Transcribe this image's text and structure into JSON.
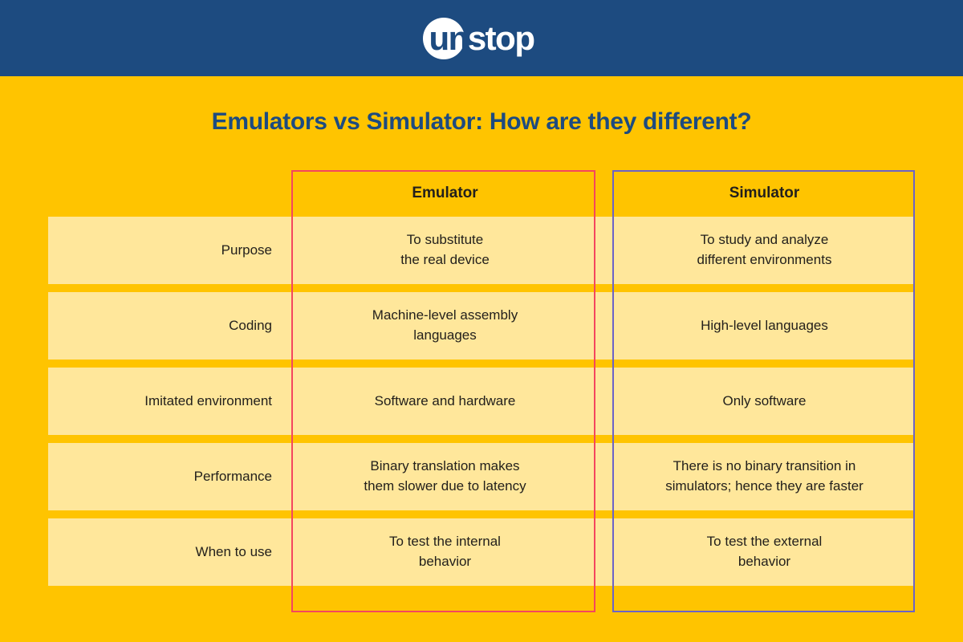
{
  "brand": {
    "logo_first": "un",
    "logo_second": "stop",
    "logo_icon": "unstop-logo"
  },
  "title": "Emulators vs Simulator: How are they different?",
  "colors": {
    "brandbar_blue": "#1D4B80",
    "background_gold": "#FFC400",
    "row_cream": "#FFE79B",
    "emulator_outline_red": "#F4465E",
    "simulator_outline_purple": "#6C63C7",
    "title_blue": "#1D4B80",
    "body_text": "#23201C"
  },
  "table": {
    "columns": [
      {
        "key": "attribute",
        "label": ""
      },
      {
        "key": "emulator",
        "label": "Emulator"
      },
      {
        "key": "simulator",
        "label": "Simulator"
      }
    ],
    "rows": [
      {
        "attribute": "Purpose",
        "emulator": "To substitute\nthe real device",
        "simulator": "To study and analyze\ndifferent environments"
      },
      {
        "attribute": "Coding",
        "emulator": "Machine-level assembly\nlanguages",
        "simulator": "High-level languages"
      },
      {
        "attribute": "Imitated environment",
        "emulator": "Software and hardware",
        "simulator": "Only software"
      },
      {
        "attribute": "Performance",
        "emulator": "Binary translation makes\nthem slower due to latency",
        "simulator": "There is no binary transition in\nsimulators; hence they are faster"
      },
      {
        "attribute": "When to use",
        "emulator": "To test the internal\nbehavior",
        "simulator": "To test the external\nbehavior"
      }
    ]
  }
}
